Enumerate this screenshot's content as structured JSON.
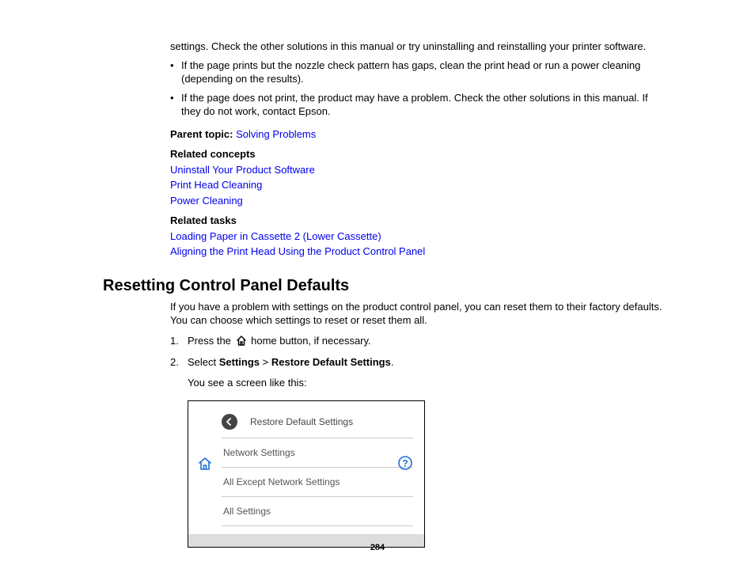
{
  "intro_continuation": "settings. Check the other solutions in this manual or try uninstalling and reinstalling your printer software.",
  "bullets": [
    "If the page prints but the nozzle check pattern has gaps, clean the print head or run a power cleaning (depending on the results).",
    "If the page does not print, the product may have a problem. Check the other solutions in this manual. If they do not work, contact Epson."
  ],
  "parent_topic_label": "Parent topic:",
  "parent_topic_link": "Solving Problems",
  "related_concepts_label": "Related concepts",
  "related_concepts_links": [
    "Uninstall Your Product Software",
    "Print Head Cleaning",
    "Power Cleaning"
  ],
  "related_tasks_label": "Related tasks",
  "related_tasks_links": [
    "Loading Paper in Cassette 2 (Lower Cassette)",
    "Aligning the Print Head Using the Product Control Panel"
  ],
  "section_title": "Resetting Control Panel Defaults",
  "section_intro": "If you have a problem with settings on the product control panel, you can reset them to their factory defaults. You can choose which settings to reset or reset them all.",
  "step1_pre": "Press the ",
  "step1_post": " home button, if necessary.",
  "step2_pre": "Select ",
  "step2_bold1": "Settings",
  "step2_gt": " > ",
  "step2_bold2": "Restore Default Settings",
  "step2_period": ".",
  "step2_result": "You see a screen like this:",
  "screenshot": {
    "title": "Restore Default Settings",
    "items": [
      "Network Settings",
      "All Except Network Settings",
      "All Settings"
    ]
  },
  "page_number": "284"
}
